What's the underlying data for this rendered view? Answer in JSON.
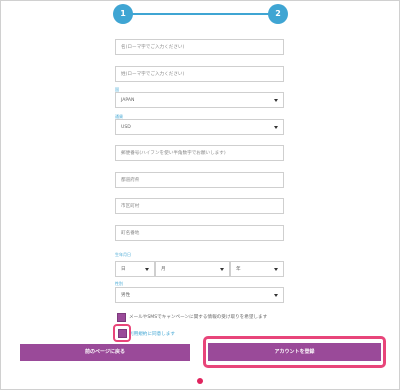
{
  "stepper": {
    "step1": "1",
    "step2": "2"
  },
  "form": {
    "first_name_placeholder": "名(ローマ字でご入力ください)",
    "last_name_placeholder": "姓(ローマ字でご入力ください)",
    "country_label": "国",
    "country_value": "JAPAN",
    "currency_label": "通貨",
    "currency_value": "USD",
    "postal_placeholder": "郵便番号(ハイフンを使い半角数字でお願いします)",
    "prefecture_placeholder": "都道府県",
    "city_placeholder": "市区町村",
    "address_placeholder": "町名番地",
    "dob_label": "生年月日",
    "dob_day": "日",
    "dob_month": "月",
    "dob_year": "年",
    "gender_label": "性別",
    "gender_value": "男性",
    "newsletter_text": "メールやSMSでキャンペーンに関する情報の受け取りを希望します",
    "terms_text": "利用規約に同意します"
  },
  "buttons": {
    "back_label": "前のページに戻る",
    "create_account_label": "アカウントを登録"
  }
}
